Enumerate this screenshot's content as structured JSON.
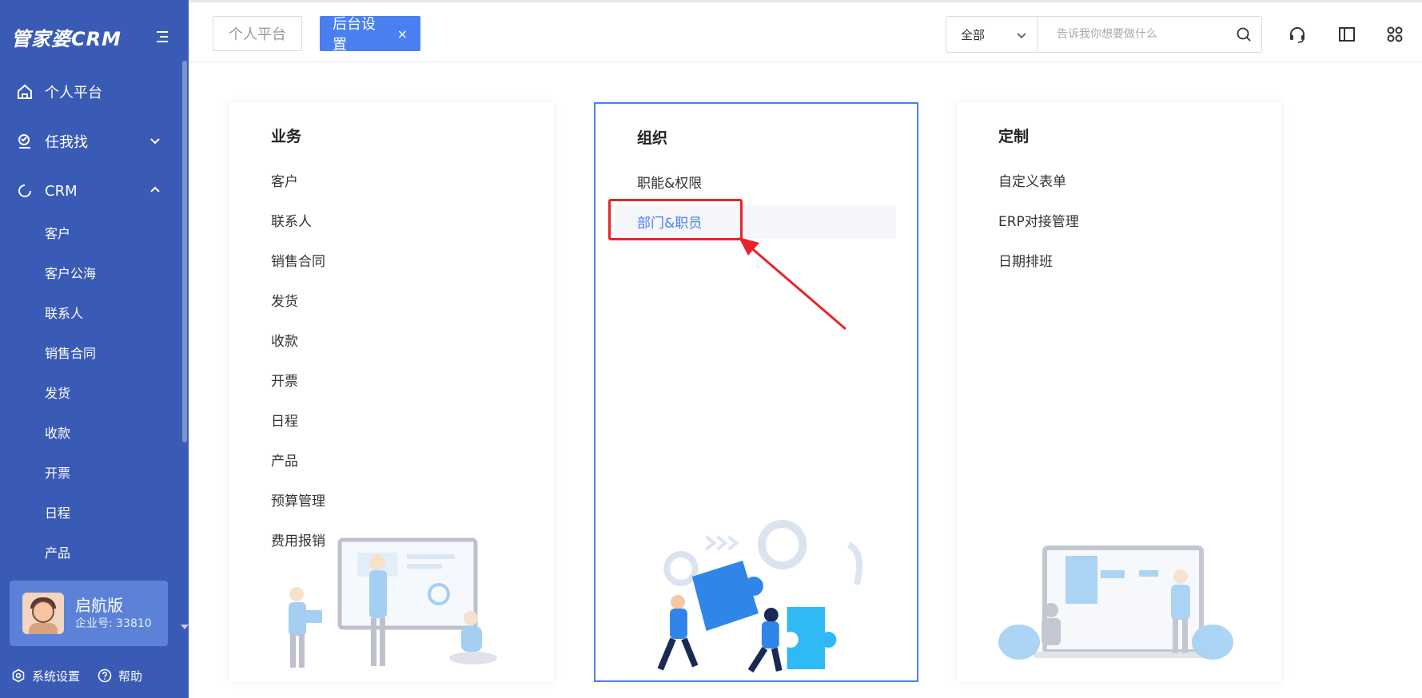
{
  "sidebar": {
    "logo": "管家婆CRM",
    "nav": [
      {
        "label": "个人平台"
      },
      {
        "label": "任我找"
      },
      {
        "label": "CRM"
      }
    ],
    "crm_sub": [
      "客户",
      "客户公海",
      "联系人",
      "销售合同",
      "发货",
      "收款",
      "开票",
      "日程",
      "产品"
    ],
    "account": {
      "name": "启航版",
      "id": "企业号: 33810"
    },
    "bottom": {
      "settings": "系统设置",
      "help": "帮助"
    }
  },
  "topbar": {
    "tabs": [
      {
        "label": "个人平台"
      },
      {
        "label": "后台设置",
        "close": "×"
      }
    ],
    "search": {
      "scope": "全部",
      "placeholder": "告诉我你想要做什么"
    }
  },
  "cards": [
    {
      "title": "业务",
      "items": [
        "客户",
        "联系人",
        "销售合同",
        "发货",
        "收款",
        "开票",
        "日程",
        "产品",
        "预算管理",
        "费用报销"
      ]
    },
    {
      "title": "组织",
      "items": [
        "职能&权限",
        "部门&职员"
      ]
    },
    {
      "title": "定制",
      "items": [
        "自定义表单",
        "ERP对接管理",
        "日期排班"
      ]
    }
  ],
  "colors": {
    "sidebar": "#3a5bb5",
    "accent": "#4a7ff0",
    "annotation": "#e8242a"
  }
}
